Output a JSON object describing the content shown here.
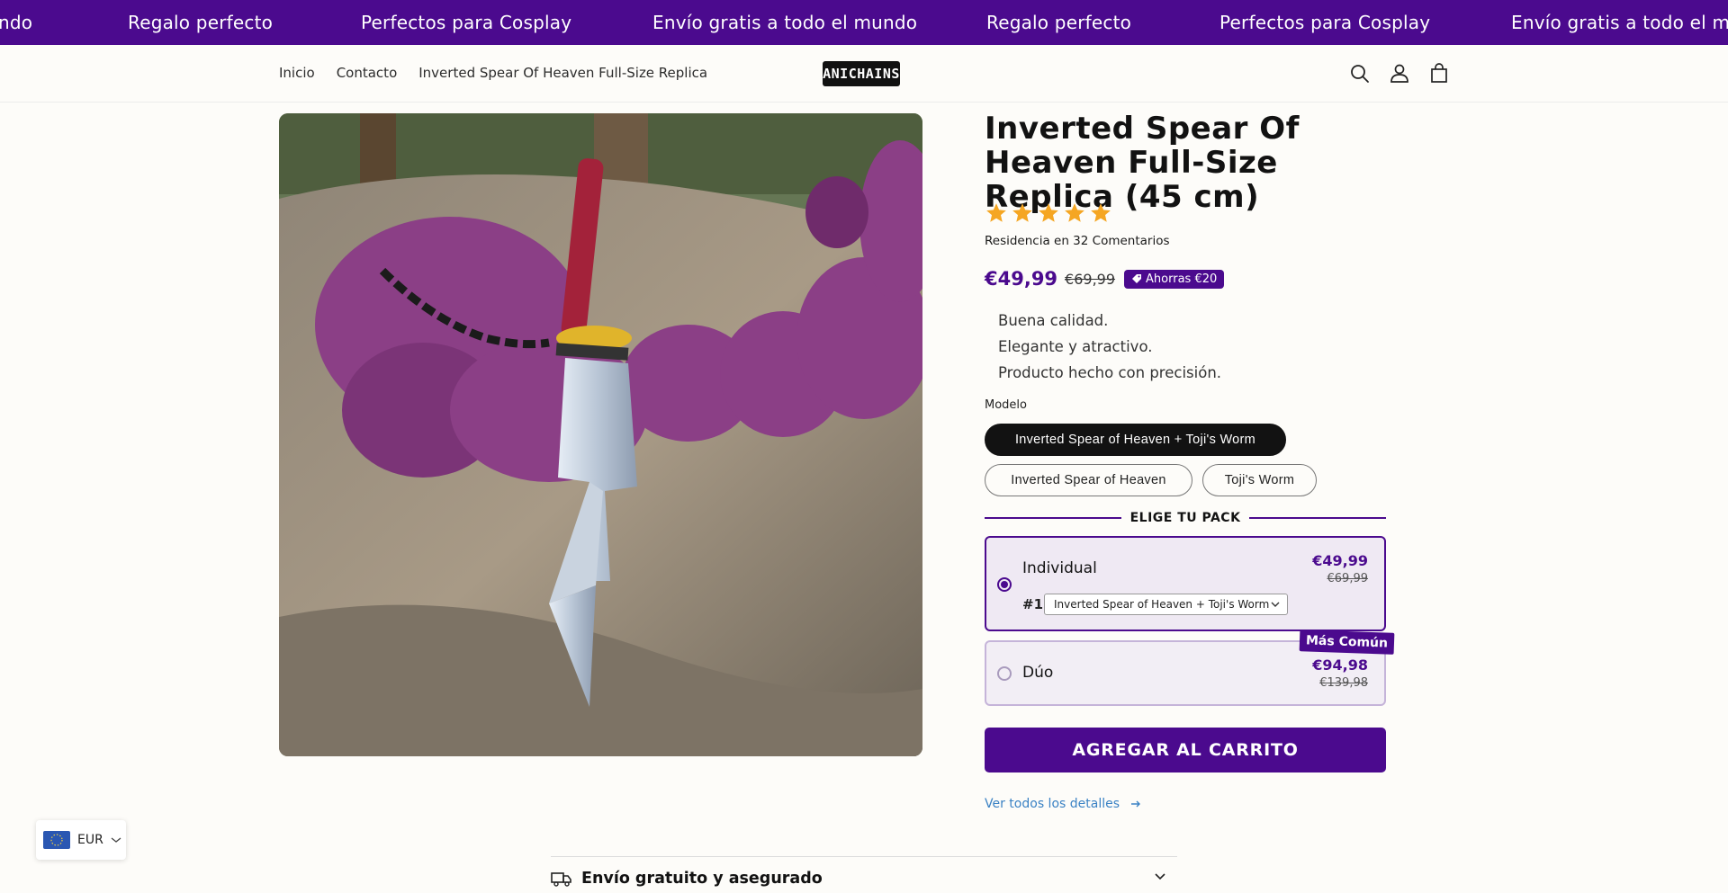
{
  "announcement": {
    "items": [
      "ndo",
      "Regalo perfecto",
      "Perfectos para Cosplay",
      "Envío gratis a todo el mundo",
      "Regalo perfecto",
      "Perfectos para Cosplay",
      "Envío gratis a todo el mundo"
    ]
  },
  "header": {
    "nav": [
      "Inicio",
      "Contacto",
      "Inverted Spear Of Heaven Full-Size Replica"
    ],
    "logo_text": "ANICHAINS",
    "icons": [
      "search-icon",
      "account-icon",
      "cart-icon"
    ]
  },
  "product": {
    "title": "Inverted Spear Of Heaven Full-Size Replica (45 cm)",
    "rating": 5,
    "reviews_text": "Residencia en 32 Comentarios",
    "price": "€49,99",
    "compare_price": "€69,99",
    "save_badge": "Ahorras €20",
    "features": [
      "Buena calidad.",
      "Elegante y atractivo.",
      "Producto hecho con precisión."
    ],
    "model_label": "Modelo",
    "models": [
      "Inverted Spear of Heaven + Toji's Worm",
      "Inverted Spear of Heaven",
      "Toji's Worm"
    ],
    "selected_model": "Inverted Spear of Heaven + Toji's Worm",
    "pack_header": "ELIGE TU PACK",
    "packs": [
      {
        "name": "Individual",
        "price": "€49,99",
        "compare": "€69,99",
        "selected": true,
        "item_number": "#1",
        "variant": "Inverted Spear of Heaven + Toji's Worm"
      },
      {
        "name": "Dúo",
        "price": "€94,98",
        "compare": "€139,98",
        "selected": false,
        "badge": "Más Común"
      }
    ],
    "add_to_cart": "AGREGAR AL CARRITO",
    "details_link": "Ver todos los detalles",
    "shipping_title": "Envío gratuito y asegurado"
  },
  "currency": {
    "code": "EUR"
  },
  "colors": {
    "brand": "#4b0a8e",
    "star": "#f5a623",
    "link": "#3b82c4"
  }
}
